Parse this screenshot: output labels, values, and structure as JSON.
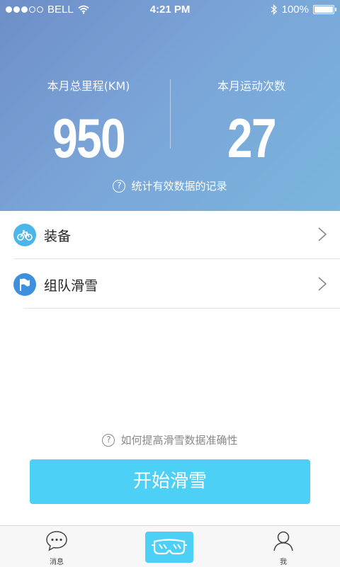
{
  "status_bar": {
    "carrier": "BELL",
    "time": "4:21 PM",
    "battery": "100%",
    "signal_bars": 3,
    "signal_total": 5
  },
  "stats": {
    "distance_label": "本月总里程(KM)",
    "distance_value": "950",
    "count_label": "本月运动次数",
    "count_value": "27",
    "info_hint": "统计有效数据的记录"
  },
  "menu": {
    "items": [
      {
        "label": "装备",
        "icon": "bicycle-icon",
        "icon_color": "#4cb6ea"
      },
      {
        "label": "组队滑雪",
        "icon": "flag-icon",
        "icon_color": "#3e8fde"
      }
    ]
  },
  "bottom": {
    "accuracy_hint": "如何提高滑雪数据准确性",
    "start_button": "开始滑雪"
  },
  "tabbar": {
    "messages_label": "消息",
    "me_label": "我",
    "center_icon": "ski-goggles-icon"
  },
  "colors": {
    "accent": "#4dd0f5",
    "hero_start": "#6d8ec7",
    "hero_end": "#7ab5dc"
  }
}
